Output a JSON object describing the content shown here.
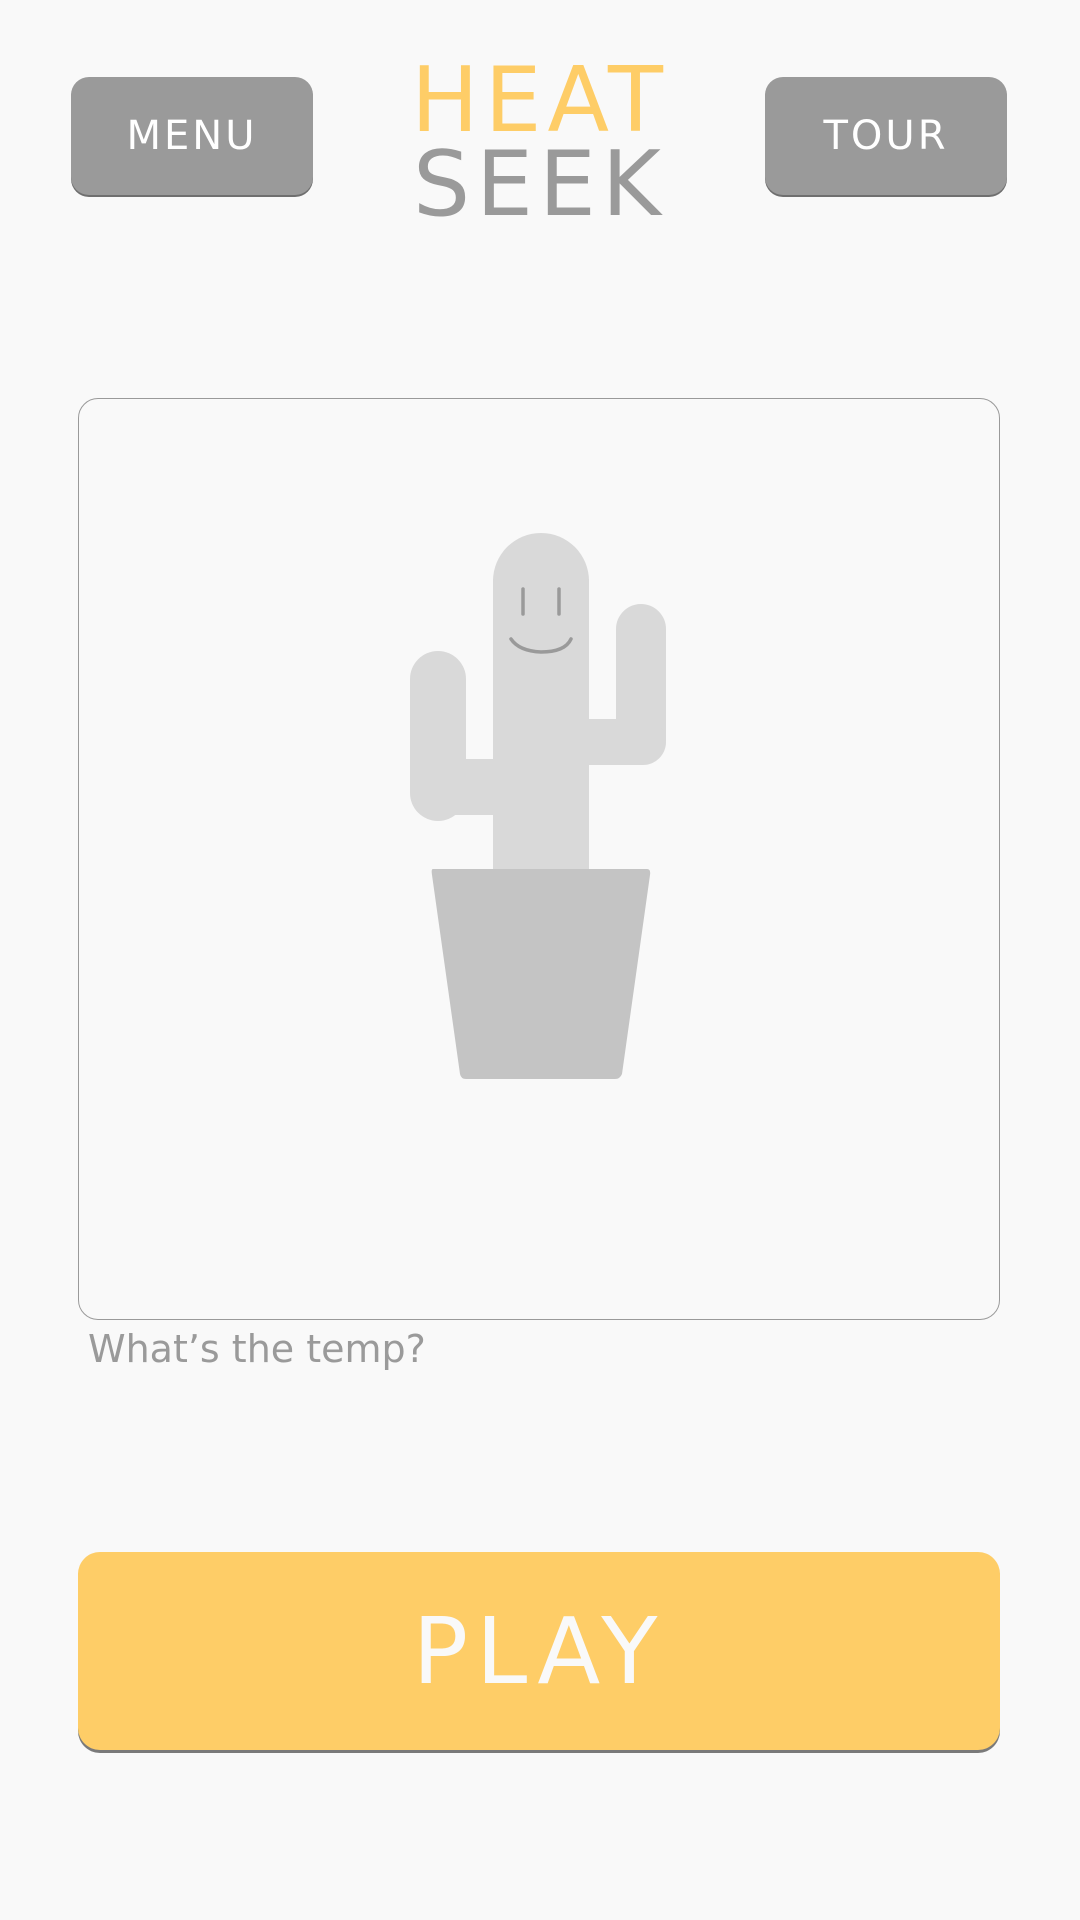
{
  "header": {
    "menu_label": "MENU",
    "tour_label": "TOUR",
    "logo_top": "HEAT",
    "logo_bottom": "SEEK"
  },
  "main": {
    "temp_prompt": "What’s the temp?",
    "play_label": "PLAY",
    "illustration": "cactus-icon"
  },
  "colors": {
    "accent": "#fecd67",
    "gray": "#9a9a9a",
    "background": "#f9f9f9",
    "cactus": "#d9d9d9",
    "pot": "#c4c4c4"
  }
}
